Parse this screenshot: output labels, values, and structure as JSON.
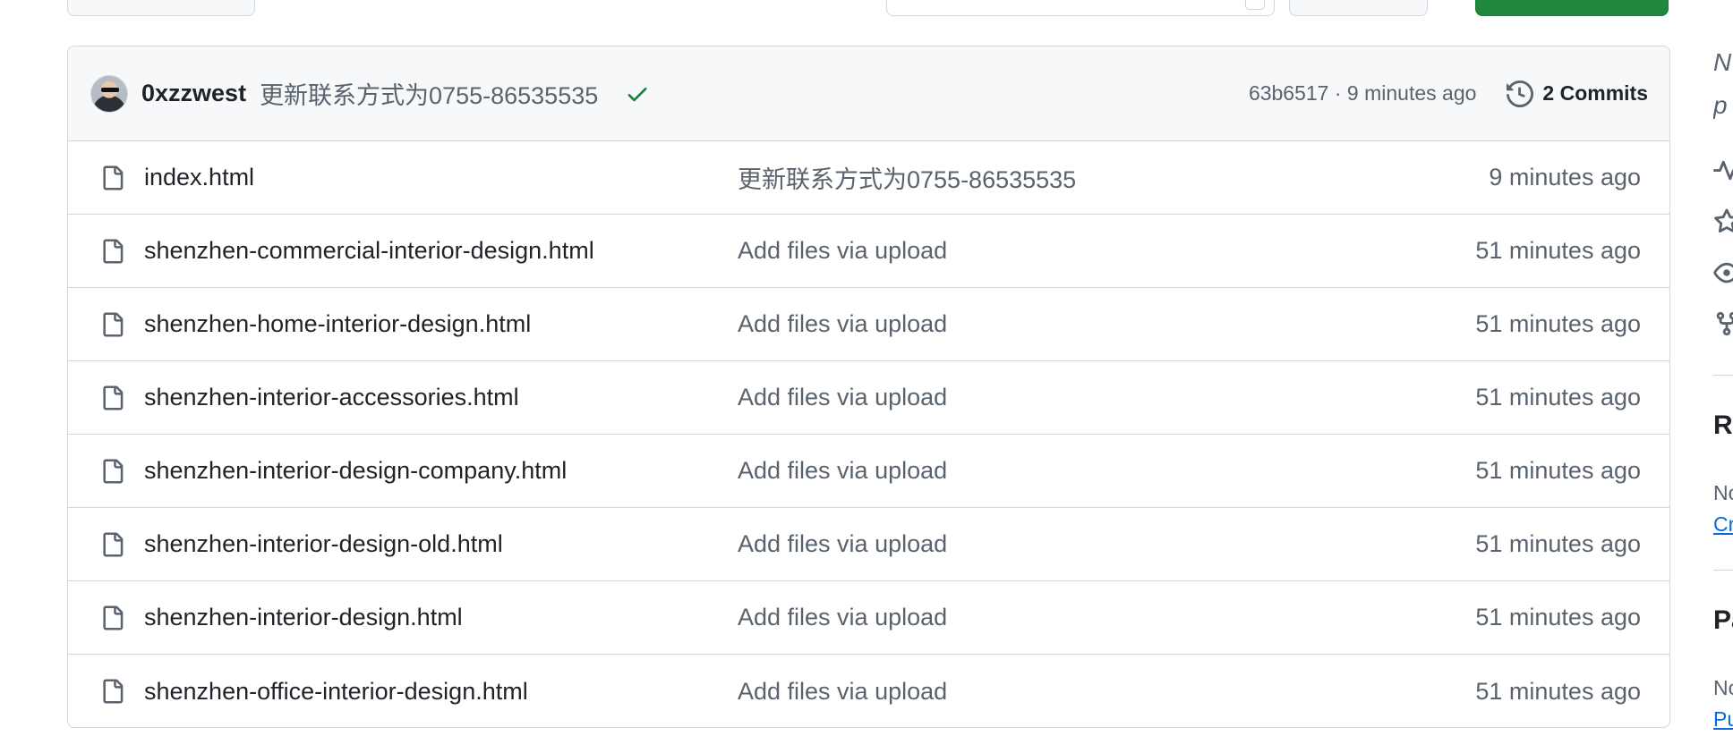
{
  "latest_commit": {
    "author": "0xzzwest",
    "message": "更新联系方式为0755-86535535",
    "status": "success",
    "meta": "63b6517 · 9 minutes ago",
    "commits_label": "2 Commits"
  },
  "files": [
    {
      "name": "index.html",
      "commit": "更新联系方式为0755-86535535",
      "age": "9 minutes ago"
    },
    {
      "name": "shenzhen-commercial-interior-design.html",
      "commit": "Add files via upload",
      "age": "51 minutes ago"
    },
    {
      "name": "shenzhen-home-interior-design.html",
      "commit": "Add files via upload",
      "age": "51 minutes ago"
    },
    {
      "name": "shenzhen-interior-accessories.html",
      "commit": "Add files via upload",
      "age": "51 minutes ago"
    },
    {
      "name": "shenzhen-interior-design-company.html",
      "commit": "Add files via upload",
      "age": "51 minutes ago"
    },
    {
      "name": "shenzhen-interior-design-old.html",
      "commit": "Add files via upload",
      "age": "51 minutes ago"
    },
    {
      "name": "shenzhen-interior-design.html",
      "commit": "Add files via upload",
      "age": "51 minutes ago"
    },
    {
      "name": "shenzhen-office-interior-design.html",
      "commit": "Add files via upload",
      "age": "51 minutes ago"
    }
  ],
  "sidebar": {
    "about_line1": "N",
    "about_line2": "p",
    "releases_heading": "R",
    "releases_note": "No",
    "releases_link": "Cr",
    "packages_heading": "Pa",
    "packages_note": "No",
    "packages_link": "Pu"
  },
  "colors": {
    "accent_green": "#1f883d",
    "link_blue": "#0969da",
    "muted_text": "#59636e",
    "border": "#d0d7de"
  }
}
